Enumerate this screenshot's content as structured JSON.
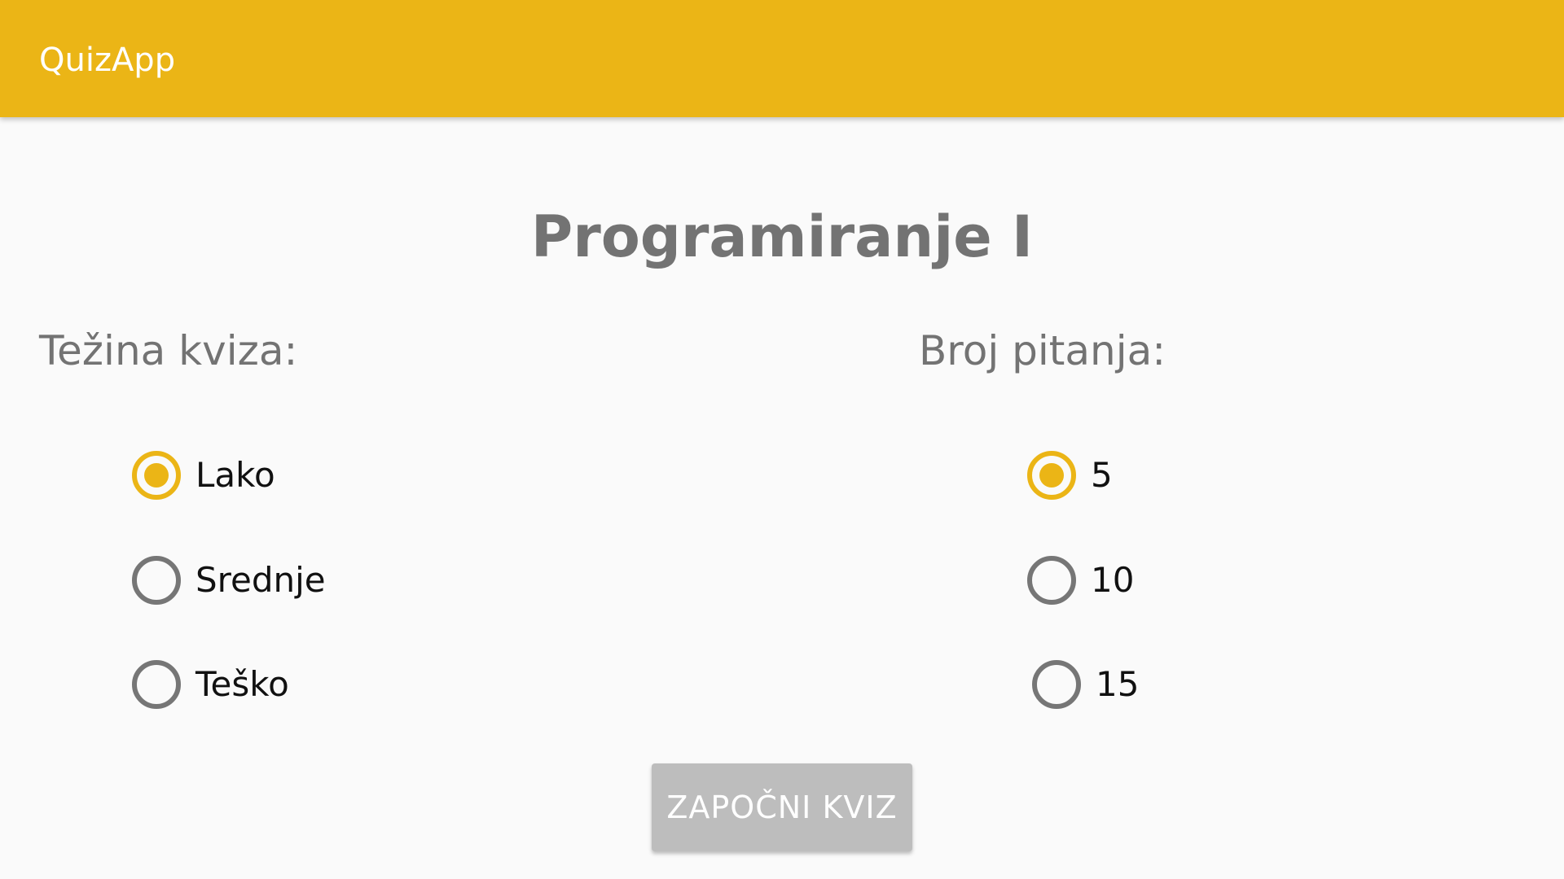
{
  "app_bar": {
    "title": "QuizApp",
    "color": "#ebb516"
  },
  "quiz": {
    "title": "Programiranje I"
  },
  "difficulty": {
    "label": "Težina kviza:",
    "options": [
      {
        "label": "Lako",
        "selected": true
      },
      {
        "label": "Srednje",
        "selected": false
      },
      {
        "label": "Teško",
        "selected": false
      }
    ]
  },
  "question_count": {
    "label": "Broj pitanja:",
    "options": [
      {
        "label": "5",
        "selected": true
      },
      {
        "label": "10",
        "selected": false
      },
      {
        "label": "15",
        "selected": false
      }
    ]
  },
  "start_button": {
    "label": "ZAPOČNI KVIZ",
    "enabled": false
  },
  "colors": {
    "accent": "#ebb516",
    "background": "#fafafa",
    "button_disabled": "#bdbdbd"
  }
}
